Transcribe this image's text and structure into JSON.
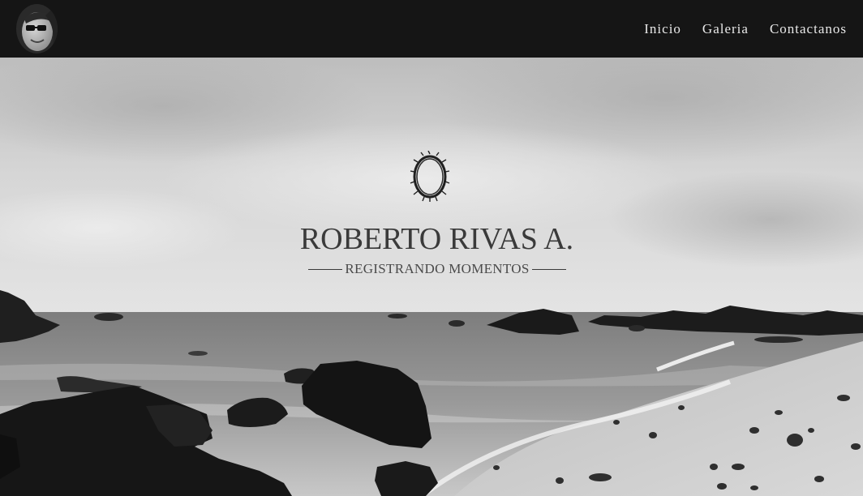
{
  "nav": {
    "links": [
      {
        "label": "Inicio"
      },
      {
        "label": "Galeria"
      },
      {
        "label": "Contactanos"
      }
    ]
  },
  "hero": {
    "title": "ROBERTO RIVAS A.",
    "tagline": "REGISTRANDO MOMENTOS"
  },
  "colors": {
    "navbar_bg": "#151515",
    "nav_text": "#e8e8e8",
    "brand_text": "#3a3a3a"
  },
  "icons": {
    "logo": "crown-of-thorns-icon",
    "profile": "avatar-photo"
  }
}
